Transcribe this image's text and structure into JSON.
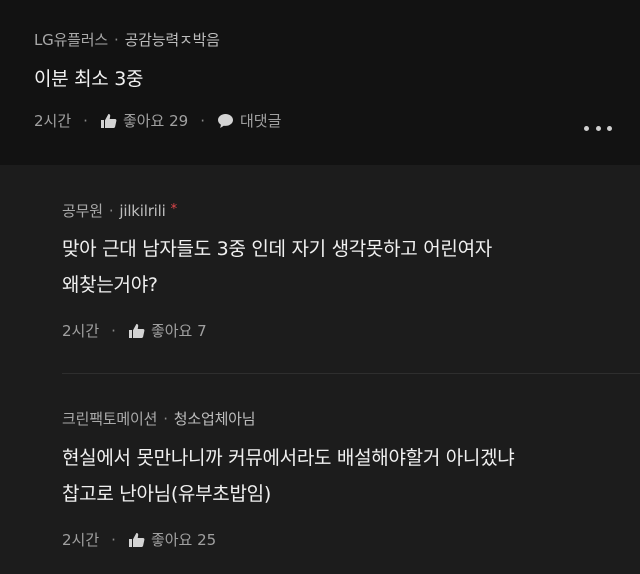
{
  "comment": {
    "author": "LG유플러스",
    "target": "공감능력ㅈ박음",
    "text": "이분 최소 3중",
    "time": "2시간",
    "likes_label": "좋아요 29",
    "reply_label": "대댓글"
  },
  "replies": [
    {
      "author": "공무원",
      "target": "jilkilrili",
      "star": "*",
      "lines": [
        "맞아 근대 남자들도 3중 인데 자기 생각못하고 어린여자",
        "왜찾는거야?"
      ],
      "time": "2시간",
      "likes_label": "좋아요 7"
    },
    {
      "author": "크린팩토메이션",
      "target": "청소업체아님",
      "lines": [
        "현실에서 못만나니까 커뮤에서라도 배설해야할거 아니겠냐",
        "찹고로 난아님(유부초밥임)"
      ],
      "time": "2시간",
      "likes_label": "좋아요 25"
    }
  ],
  "separator": "·",
  "icons": {
    "like": "thumbs-up-icon",
    "reply": "speech-bubble-icon",
    "more": "more-dots-icon"
  },
  "colors": {
    "top_bg": "#121212",
    "reply_bg": "#1c1c1c",
    "star": "#e0474c"
  }
}
